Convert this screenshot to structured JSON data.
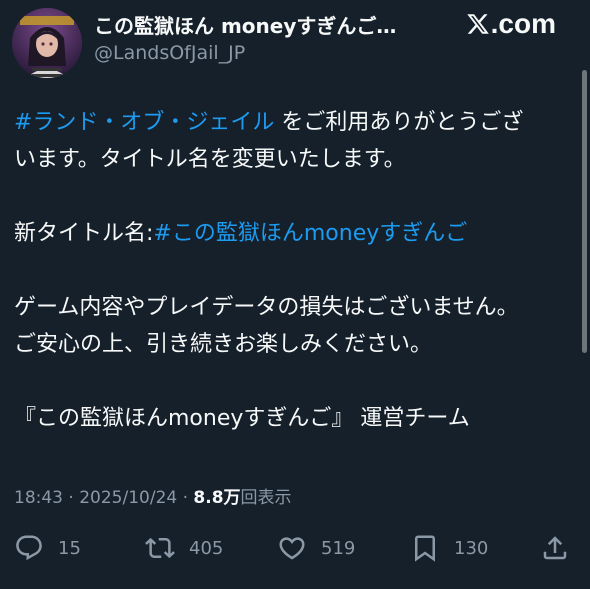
{
  "tweet": {
    "author": {
      "display_name": "この監獄ほん moneyすぎんご…",
      "handle": "@LandsOfJail_JP",
      "avatar": "avatar-image"
    },
    "brand": {
      "text": ".com",
      "icon": "x-logo-icon"
    },
    "body": {
      "line1_hashtag": "#ランド・オブ・ジェイル",
      "line1_rest": " をご利用ありがとうござ",
      "line2": "います。タイトル名を変更いたします。",
      "line3_prefix": "新タイトル名:",
      "line3_hashtag": "#この監獄ほんmoneyすぎんご",
      "line4": "ゲーム内容やプレイデータの損失はございません。",
      "line5": "ご安心の上、引き続きお楽しみください。",
      "line6": "『この監獄ほんmoneyすぎんご』 運営チーム"
    },
    "meta": {
      "time": "18:43",
      "date": "2025/10/24",
      "views_count": "8.8万",
      "views_label": "回表示"
    },
    "actions": {
      "reply_count": "15",
      "retweet_count": "405",
      "like_count": "519",
      "bookmark_count": "130"
    },
    "colors": {
      "background": "#15202b",
      "link": "#1d9bf0",
      "secondary_text": "#8b98a5",
      "primary_text": "#f7f9f9"
    }
  }
}
